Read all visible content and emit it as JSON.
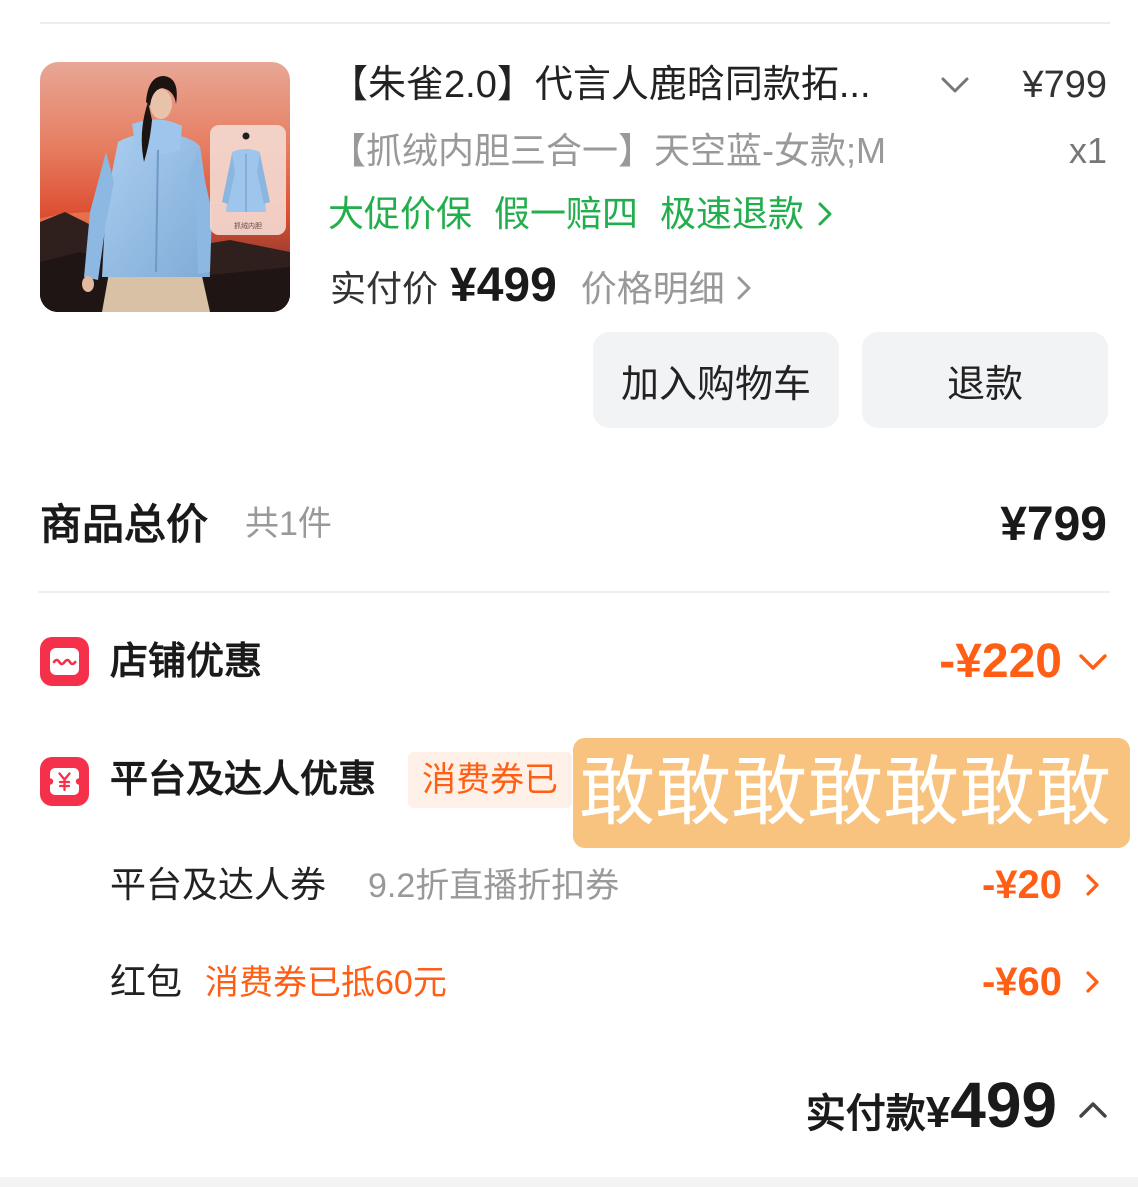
{
  "product": {
    "title": "【朱雀2.0】代言人鹿晗同款拓...",
    "price": "¥799",
    "sku": "【抓绒内胆三合一】天空蓝-女款;M",
    "quantity": "x1",
    "services": [
      "大促价保",
      "假一赔四",
      "极速退款"
    ],
    "paid_label": "实付价",
    "paid_price": "¥499",
    "price_detail_label": "价格明细",
    "image_inset_text": "抓绒内胆"
  },
  "actions": {
    "add_to_cart": "加入购物车",
    "refund": "退款"
  },
  "summary": {
    "total_label": "商品总价",
    "total_count": "共1件",
    "total_value": "¥799",
    "store_discount": {
      "label": "店铺优惠",
      "value": "-¥220"
    },
    "platform_discount": {
      "label": "平台及达人优惠",
      "badge": "消费券已"
    },
    "platform_coupon": {
      "label": "平台及达人券",
      "desc": "9.2折直播折扣券",
      "value": "-¥20"
    },
    "red_packet": {
      "label": "红包",
      "desc": "消费券已抵60元",
      "value": "-¥60"
    },
    "final": {
      "label": "实付款",
      "currency": "¥",
      "amount": "499"
    }
  },
  "overlay": {
    "text": "敢敢敢敢敢敢敢"
  },
  "colors": {
    "accent_orange": "#FF5E14",
    "service_green": "#22AE4C",
    "icon_red": "#F5304B",
    "overlay_bg": "#F8C27F",
    "badge_bg": "#FFF1E7"
  },
  "icons": {
    "title_expand": "chevron-down-icon",
    "service_more": "chevron-right-icon",
    "price_detail": "chevron-right-icon",
    "store_discount": "store-icon",
    "store_expand": "chevron-down-icon",
    "platform_discount": "yuan-ticket-icon",
    "row_more": "chevron-right-icon",
    "final_collapse": "chevron-up-icon"
  }
}
